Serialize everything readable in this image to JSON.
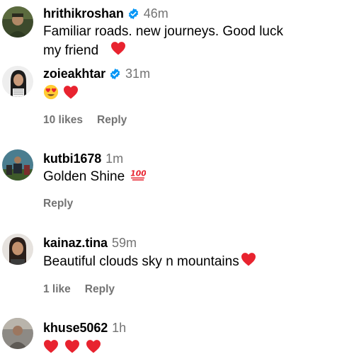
{
  "comments": [
    {
      "username": "hrithikroshan",
      "verified": true,
      "time": "46m",
      "text": "Familiar roads. new journeys. Good luck my friend",
      "emojis": [
        "red-heart"
      ]
    },
    {
      "username": "zoieakhtar",
      "verified": true,
      "time": "31m",
      "text": "",
      "emojis": [
        "heart-eyes",
        "red-heart"
      ],
      "likes": "10 likes",
      "reply": "Reply"
    },
    {
      "username": "kutbi1678",
      "verified": false,
      "time": "1m",
      "text": "Golden Shine",
      "emojis": [
        "hundred-points"
      ],
      "reply": "Reply"
    },
    {
      "username": "kainaz.tina",
      "verified": false,
      "time": "59m",
      "text": "Beautiful clouds sky n mountains",
      "emojis": [
        "red-heart"
      ],
      "likes": "1 like",
      "reply": "Reply"
    },
    {
      "username": "khuse5062",
      "verified": false,
      "time": "1h",
      "text": "",
      "emojis": [
        "red-heart",
        "red-heart",
        "red-heart"
      ]
    }
  ],
  "colors": {
    "verified_badge": "#0095f6",
    "secondary_text": "#737373",
    "heart": "#e8232f"
  }
}
